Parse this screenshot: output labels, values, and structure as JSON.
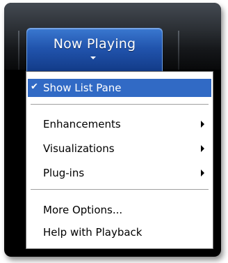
{
  "tab": {
    "label": "Now Playing"
  },
  "menu": {
    "items": [
      {
        "label": "Show List Pane",
        "checked": true,
        "highlighted": true,
        "has_submenu": false
      },
      {
        "label": "Enhancements",
        "checked": false,
        "highlighted": false,
        "has_submenu": true
      },
      {
        "label": "Visualizations",
        "checked": false,
        "highlighted": false,
        "has_submenu": true
      },
      {
        "label": "Plug-ins",
        "checked": false,
        "highlighted": false,
        "has_submenu": true
      },
      {
        "label": "More Options...",
        "checked": false,
        "highlighted": false,
        "has_submenu": false
      },
      {
        "label": "Help with Playback",
        "checked": false,
        "highlighted": false,
        "has_submenu": false
      }
    ]
  },
  "icons": {
    "check": "checkmark-icon",
    "submenu": "submenu-arrow-icon",
    "dropdown": "dropdown-arrow-icon"
  },
  "colors": {
    "highlight": "#316ac5",
    "tab_top": "#3a78d0",
    "tab_bottom": "#123a87"
  }
}
